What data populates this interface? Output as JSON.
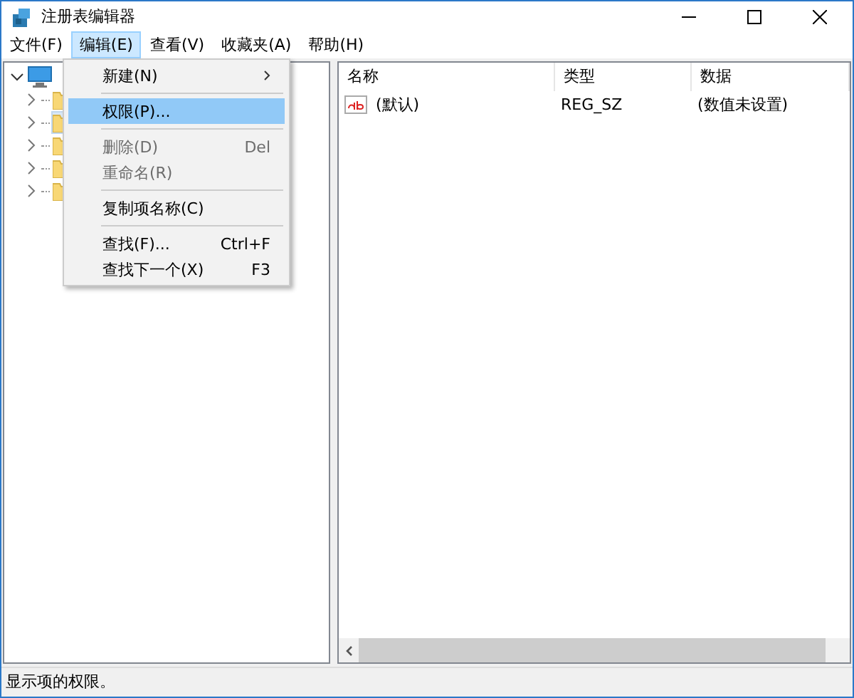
{
  "window": {
    "title": "注册表编辑器"
  },
  "menu_bar": [
    {
      "label": "文件(F)",
      "selected": false
    },
    {
      "label": "编辑(E)",
      "selected": true
    },
    {
      "label": "查看(V)",
      "selected": false
    },
    {
      "label": "收藏夹(A)",
      "selected": false
    },
    {
      "label": "帮助(H)",
      "selected": false
    }
  ],
  "edit_menu": {
    "items": [
      {
        "kind": "submenu",
        "label": "新建(N)",
        "disabled": false,
        "selected": false
      },
      {
        "kind": "separator"
      },
      {
        "kind": "item",
        "label": "权限(P)...",
        "disabled": false,
        "selected": true
      },
      {
        "kind": "separator"
      },
      {
        "kind": "item",
        "label": "删除(D)",
        "shortcut": "Del",
        "disabled": true,
        "selected": false
      },
      {
        "kind": "item",
        "label": "重命名(R)",
        "disabled": true,
        "selected": false
      },
      {
        "kind": "separator"
      },
      {
        "kind": "item",
        "label": "复制项名称(C)",
        "disabled": false,
        "selected": false
      },
      {
        "kind": "separator"
      },
      {
        "kind": "item",
        "label": "查找(F)...",
        "shortcut": "Ctrl+F",
        "disabled": false,
        "selected": false
      },
      {
        "kind": "item",
        "label": "查找下一个(X)",
        "shortcut": "F3",
        "disabled": false,
        "selected": false
      }
    ]
  },
  "tree": {
    "root": {
      "expanded": true,
      "children": [
        {
          "expanded": false,
          "selected": false
        },
        {
          "expanded": false,
          "selected": true
        },
        {
          "expanded": false,
          "selected": false
        },
        {
          "expanded": false,
          "selected": false
        },
        {
          "expanded": false,
          "selected": false
        }
      ]
    }
  },
  "values_list": {
    "columns": [
      "名称",
      "类型",
      "数据"
    ],
    "rows": [
      {
        "name": "(默认)",
        "type": "REG_SZ",
        "data": "(数值未设置)"
      }
    ]
  },
  "status_bar": "显示项的权限。"
}
